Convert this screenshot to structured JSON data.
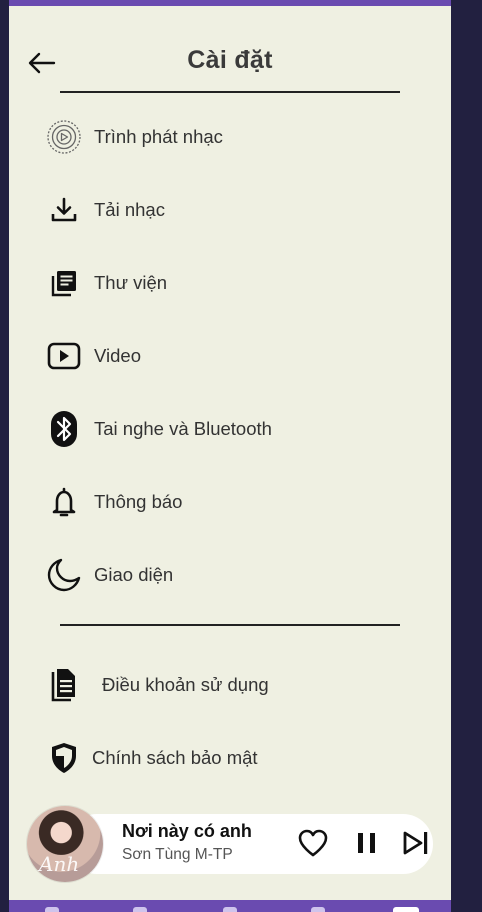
{
  "header": {
    "title": "Cài đặt"
  },
  "settings": {
    "items": [
      {
        "label": "Trình phát nhạc",
        "icon": "music-player-icon"
      },
      {
        "label": "Tải nhạc",
        "icon": "download-icon"
      },
      {
        "label": "Thư viện",
        "icon": "library-icon"
      },
      {
        "label": "Video",
        "icon": "video-icon"
      },
      {
        "label": "Tai nghe và Bluetooth",
        "icon": "bluetooth-icon"
      },
      {
        "label": "Thông báo",
        "icon": "bell-icon"
      },
      {
        "label": "Giao diện",
        "icon": "moon-icon"
      }
    ],
    "secondary": [
      {
        "label": "Điều khoản sử dụng",
        "icon": "document-icon"
      },
      {
        "label": "Chính sách bảo mật",
        "icon": "shield-icon"
      }
    ]
  },
  "player": {
    "title": "Nơi này có anh",
    "artist": "Sơn Tùng M-TP",
    "art_text": "Anh"
  },
  "colors": {
    "accent": "#6a4bb0",
    "background": "#eff0e2",
    "outer": "#222040"
  }
}
